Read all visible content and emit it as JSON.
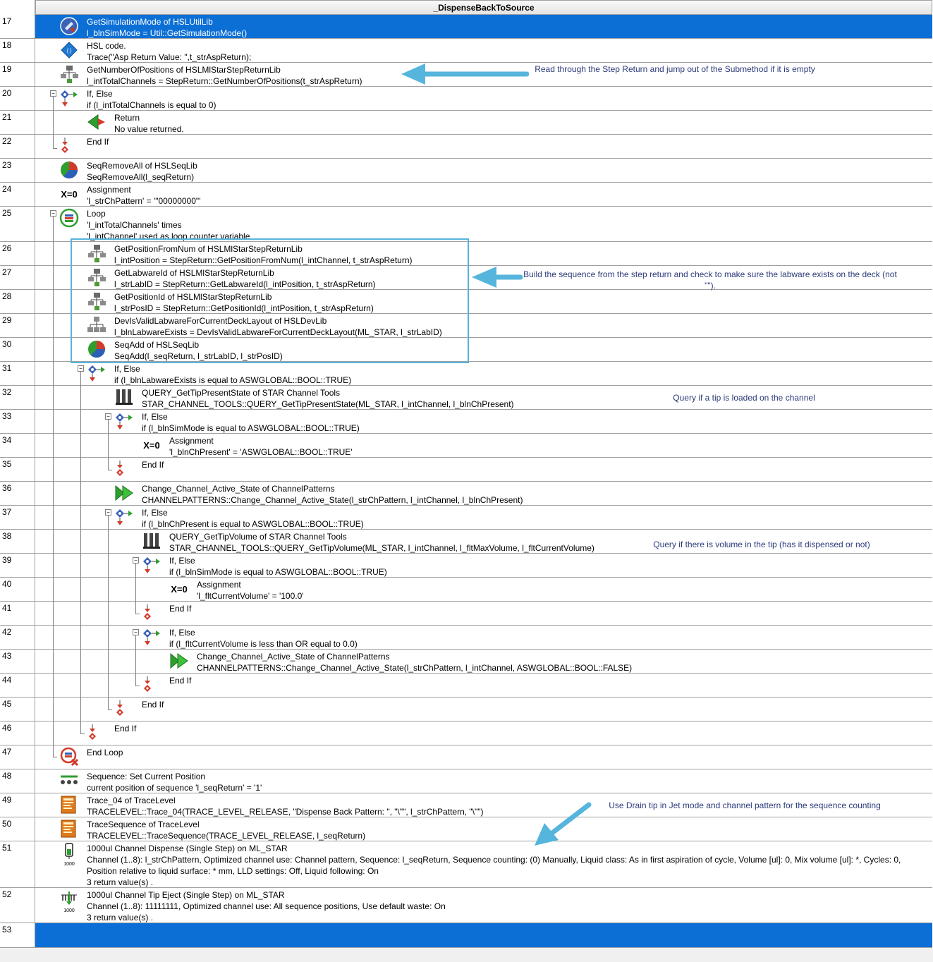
{
  "title": "_DispenseBackToSource",
  "colors": {
    "selection": "#0c6fd6",
    "grid": "#a0a0a0",
    "note": "#2b3a7a",
    "arrow": "#55b5dc"
  },
  "rows": [
    {
      "n": "17",
      "icon": "util-icon",
      "lines": [
        "GetSimulationMode of HSLUtilLib",
        "l_blnSimMode = Util::GetSimulationMode()"
      ]
    },
    {
      "n": "18",
      "icon": "hsl-code-icon",
      "lines": [
        "HSL code.",
        "Trace(\"Asp Return Value:  \",t_strAspReturn);"
      ]
    },
    {
      "n": "19",
      "icon": "library-tree-icon",
      "lines": [
        "GetNumberOfPositions of HSLMlStarStepReturnLib",
        "l_intTotalChannels = StepReturn::GetNumberOfPositions(t_strAspReturn)"
      ]
    },
    {
      "n": "20",
      "icon": "if-else-icon",
      "lines": [
        "If, Else",
        "if (l_intTotalChannels is equal to 0)"
      ]
    },
    {
      "n": "21",
      "icon": "return-icon",
      "lines": [
        "Return",
        "No value returned."
      ]
    },
    {
      "n": "22",
      "icon": "end-if-icon",
      "lines": [
        "End If"
      ]
    },
    {
      "n": "23",
      "icon": "sequence-lib-icon",
      "lines": [
        "SeqRemoveAll of HSLSeqLib",
        "SeqRemoveAll(l_seqReturn)"
      ]
    },
    {
      "n": "24",
      "icon": "assignment-icon",
      "lines": [
        "Assignment",
        "'l_strChPattern' = '\"00000000\"'"
      ]
    },
    {
      "n": "25",
      "icon": "loop-icon",
      "lines": [
        "Loop",
        "'l_intTotalChannels' times",
        "'l_intChannel' used as loop counter variable"
      ]
    },
    {
      "n": "26",
      "icon": "library-tree-icon",
      "lines": [
        "GetPositionFromNum of HSLMlStarStepReturnLib",
        "l_intPosition = StepReturn::GetPositionFromNum(l_intChannel, t_strAspReturn)"
      ]
    },
    {
      "n": "27",
      "icon": "library-tree-icon",
      "lines": [
        "GetLabwareId of HSLMlStarStepReturnLib",
        "l_strLabID = StepReturn::GetLabwareId(l_intPosition, t_strAspReturn)"
      ]
    },
    {
      "n": "28",
      "icon": "library-tree-icon",
      "lines": [
        "GetPositionId of HSLMlStarStepReturnLib",
        "l_strPosID = StepReturn::GetPositionId(l_intPosition, t_strAspReturn)"
      ]
    },
    {
      "n": "29",
      "icon": "device-lib-icon",
      "lines": [
        "DevIsValidLabwareForCurrentDeckLayout of HSLDevLib",
        "l_blnLabwareExists = DevIsValidLabwareForCurrentDeckLayout(ML_STAR, l_strLabID)"
      ]
    },
    {
      "n": "30",
      "icon": "sequence-lib-icon",
      "lines": [
        "SeqAdd of HSLSeqLib",
        "SeqAdd(l_seqReturn, l_strLabID, l_strPosID)"
      ]
    },
    {
      "n": "31",
      "icon": "if-else-icon",
      "lines": [
        "If, Else",
        "if (l_blnLabwareExists is equal to ASWGLOBAL::BOOL::TRUE)"
      ]
    },
    {
      "n": "32",
      "icon": "channel-tools-icon",
      "lines": [
        "QUERY_GetTipPresentState of STAR Channel Tools",
        "STAR_CHANNEL_TOOLS::QUERY_GetTipPresentState(ML_STAR, l_intChannel, l_blnChPresent)"
      ]
    },
    {
      "n": "33",
      "icon": "if-else-icon",
      "lines": [
        "If, Else",
        "if (l_blnSimMode is equal to ASWGLOBAL::BOOL::TRUE)"
      ]
    },
    {
      "n": "34",
      "icon": "assignment-icon",
      "lines": [
        "Assignment",
        "'l_blnChPresent' = 'ASWGLOBAL::BOOL::TRUE'"
      ]
    },
    {
      "n": "35",
      "icon": "end-if-icon",
      "lines": [
        "End If"
      ]
    },
    {
      "n": "36",
      "icon": "channel-pattern-icon",
      "lines": [
        "Change_Channel_Active_State of ChannelPatterns",
        "CHANNELPATTERNS::Change_Channel_Active_State(l_strChPattern, l_intChannel, l_blnChPresent)"
      ]
    },
    {
      "n": "37",
      "icon": "if-else-icon",
      "lines": [
        "If, Else",
        "if (l_blnChPresent is equal to ASWGLOBAL::BOOL::TRUE)"
      ]
    },
    {
      "n": "38",
      "icon": "channel-tools-icon",
      "lines": [
        "QUERY_GetTipVolume of STAR Channel Tools",
        "STAR_CHANNEL_TOOLS::QUERY_GetTipVolume(ML_STAR, l_intChannel, l_fltMaxVolume, l_fltCurrentVolume)"
      ]
    },
    {
      "n": "39",
      "icon": "if-else-icon",
      "lines": [
        "If, Else",
        "if (l_blnSimMode is equal to ASWGLOBAL::BOOL::TRUE)"
      ]
    },
    {
      "n": "40",
      "icon": "assignment-icon",
      "lines": [
        "Assignment",
        "'l_fltCurrentVolume' = '100.0'"
      ]
    },
    {
      "n": "41",
      "icon": "end-if-icon",
      "lines": [
        "End If"
      ]
    },
    {
      "n": "42",
      "icon": "if-else-icon",
      "lines": [
        "If, Else",
        "if (l_fltCurrentVolume is less than OR equal to 0.0)"
      ]
    },
    {
      "n": "43",
      "icon": "channel-pattern-icon",
      "lines": [
        "Change_Channel_Active_State of ChannelPatterns",
        "CHANNELPATTERNS::Change_Channel_Active_State(l_strChPattern, l_intChannel, ASWGLOBAL::BOOL::FALSE)"
      ]
    },
    {
      "n": "44",
      "icon": "end-if-icon",
      "lines": [
        "End If"
      ]
    },
    {
      "n": "45",
      "icon": "end-if-icon",
      "lines": [
        "End If"
      ]
    },
    {
      "n": "46",
      "icon": "end-if-icon",
      "lines": [
        "End If"
      ]
    },
    {
      "n": "47",
      "icon": "end-loop-icon",
      "lines": [
        "End Loop"
      ]
    },
    {
      "n": "48",
      "icon": "sequence-position-icon",
      "lines": [
        "Sequence: Set Current Position",
        "current position of sequence 'l_seqReturn' = '1'"
      ]
    },
    {
      "n": "49",
      "icon": "trace-icon",
      "lines": [
        "Trace_04 of TraceLevel",
        "TRACELEVEL::Trace_04(TRACE_LEVEL_RELEASE, \"Dispense Back Pattern:  \", \"\\\"\", l_strChPattern, \"\\\"\")"
      ]
    },
    {
      "n": "50",
      "icon": "trace-icon",
      "lines": [
        "TraceSequence of TraceLevel",
        "TRACELEVEL::TraceSequence(TRACE_LEVEL_RELEASE, l_seqReturn)"
      ]
    },
    {
      "n": "51",
      "icon": "dispense-icon",
      "lines": [
        "1000ul Channel Dispense (Single Step) on ML_STAR",
        "Channel (1..8): l_strChPattern, Optimized channel use: Channel pattern, Sequence: l_seqReturn, Sequence counting: (0) Manually, Liquid class: As in first aspiration of cycle, Volume [ul]: 0, Mix volume [ul]: *, Cycles: 0, Position relative to liquid surface: * mm, LLD settings: Off, Liquid following: On",
        "3 return value(s) ."
      ]
    },
    {
      "n": "52",
      "icon": "tip-eject-icon",
      "lines": [
        "1000ul Channel Tip Eject (Single Step) on ML_STAR",
        "Channel (1..8): 11111111, Optimized channel use: All sequence positions, Use default waste: On",
        "3 return value(s) ."
      ]
    },
    {
      "n": "53",
      "icon": "",
      "lines": []
    }
  ],
  "notes": {
    "step_return": "Read through the Step Return and jump out of the Submethod if it is empty",
    "build_sequence": "Build the sequence from the step return and check to make sure the labware exists on the deck (not \"\").",
    "query_tip": "Query if a tip is loaded on the channel",
    "query_volume": "Query if there is volume in the tip (has it dispensed or not)",
    "drain_tip": "Use Drain tip in Jet mode and channel pattern for the sequence counting"
  },
  "icon_labels": {
    "assignment": "X=0",
    "volume": "1000"
  }
}
